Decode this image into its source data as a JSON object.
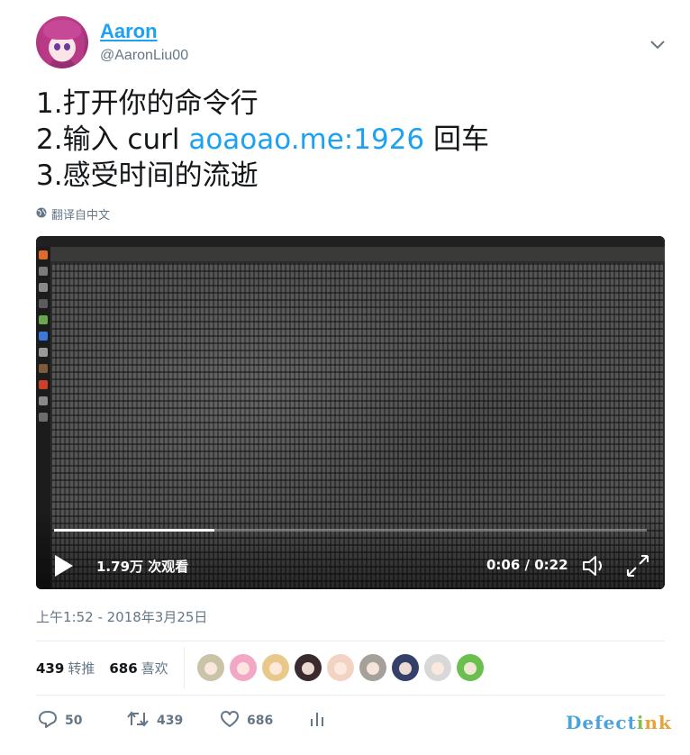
{
  "author": {
    "name": "Aaron",
    "handle": "@AaronLiu00"
  },
  "tweet": {
    "lines": [
      {
        "text": "1.打开你的命令行"
      },
      {
        "prefix": "2.输入 curl ",
        "link": "aoaoao.me:1926",
        "suffix": " 回车"
      },
      {
        "text": "3.感受时间的流逝"
      }
    ],
    "translate_label": "翻译自中文"
  },
  "video": {
    "views": "1.79万 次观看",
    "time": "0:06 / 0:22",
    "progress": 0.27
  },
  "timestamp": "上午1:52 - 2018年3月25日",
  "stats": {
    "retweets_count": "439",
    "retweets_label": "转推",
    "likes_count": "686",
    "likes_label": "喜欢"
  },
  "liker_avatar_colors": [
    "#c9c3a8",
    "#f2a7c4",
    "#e8c98a",
    "#3a2a2e",
    "#f3d3c4",
    "#a5a09a",
    "#35406a",
    "#d8d8d8",
    "#6bbf4e"
  ],
  "actions": {
    "replies": "50",
    "retweets": "439",
    "likes": "686"
  },
  "watermark": {
    "part1": "Defect",
    "part2": "i",
    "part3": "nk"
  },
  "colors": {
    "accent": "#1da1f2",
    "muted": "#657786"
  }
}
